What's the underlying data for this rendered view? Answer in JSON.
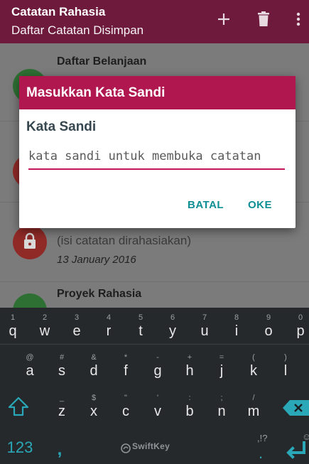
{
  "appbar": {
    "title": "Catatan Rahasia",
    "subtitle": "Daftar Catatan Disimpan",
    "bg": "#6d1a3d",
    "actions": [
      "add-icon",
      "trash-icon",
      "more-vert-icon"
    ]
  },
  "notes": [
    {
      "title": "Daftar Belanjaan",
      "avatar_color": "#2e7d32"
    },
    {
      "title": "",
      "avatar_color": "#c62828"
    },
    {
      "body": "(isi catatan dirahasiakan)",
      "date": "13 January 2016",
      "avatar_color": "#c62828"
    },
    {
      "title": "Proyek Rahasia",
      "avatar_color": "#2e7d32"
    }
  ],
  "dialog": {
    "title": "Masukkan Kata Sandi",
    "label": "Kata Sandi",
    "input_value": "",
    "input_placeholder": "kata sandi untuk membuka catatan",
    "cancel_label": "BATAL",
    "ok_label": "OKE",
    "header_color": "#b0174f",
    "accent_color": "#0e8f93"
  },
  "keyboard": {
    "row1": [
      {
        "k": "q",
        "s": "1"
      },
      {
        "k": "w",
        "s": "2"
      },
      {
        "k": "e",
        "s": "3"
      },
      {
        "k": "r",
        "s": "4"
      },
      {
        "k": "t",
        "s": "5"
      },
      {
        "k": "y",
        "s": "6"
      },
      {
        "k": "u",
        "s": "7"
      },
      {
        "k": "i",
        "s": "8"
      },
      {
        "k": "o",
        "s": "9"
      },
      {
        "k": "p",
        "s": "0"
      }
    ],
    "row2": [
      {
        "k": "a",
        "s": "@"
      },
      {
        "k": "s",
        "s": "#"
      },
      {
        "k": "d",
        "s": "&"
      },
      {
        "k": "f",
        "s": "*"
      },
      {
        "k": "g",
        "s": "-"
      },
      {
        "k": "h",
        "s": "+"
      },
      {
        "k": "j",
        "s": "="
      },
      {
        "k": "k",
        "s": "("
      },
      {
        "k": "l",
        "s": ")"
      }
    ],
    "row3": [
      {
        "k": "z",
        "s": "_"
      },
      {
        "k": "x",
        "s": "$"
      },
      {
        "k": "c",
        "s": "\""
      },
      {
        "k": "v",
        "s": "'"
      },
      {
        "k": "b",
        "s": ":"
      },
      {
        "k": "n",
        "s": ";"
      },
      {
        "k": "m",
        "s": "/"
      }
    ],
    "numbers_label": "123",
    "comma_label": ",",
    "brand_label": "SwiftKey",
    "period_label": ".",
    "period_sub": ",!?",
    "emoji_sub": "☺",
    "accent_color": "#2aa8b8"
  }
}
